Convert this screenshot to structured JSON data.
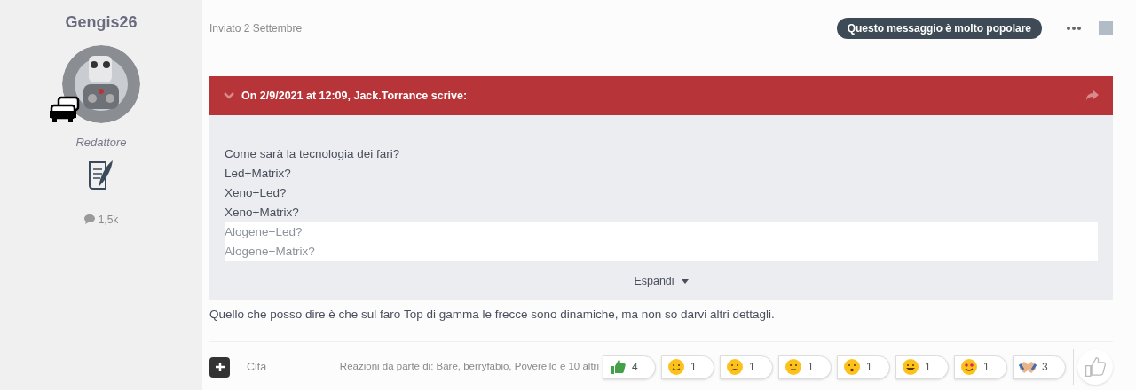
{
  "author": {
    "name": "Gengis26",
    "role": "Redattore",
    "posts": "1,5k"
  },
  "post": {
    "date": "Inviato 2 Settembre",
    "badge": "Questo messaggio è molto popolare",
    "select_checked": false,
    "quote": {
      "header": "On 2/9/2021 at 12:09, Jack.Torrance scrive:",
      "expanded": false,
      "lines": [
        {
          "text": "Come sarà la tecnologia dei fari?",
          "faded": false
        },
        {
          "text": "Led+Matrix?",
          "faded": false
        },
        {
          "text": "Xeno+Led?",
          "faded": false
        },
        {
          "text": "Xeno+Matrix?",
          "faded": false
        },
        {
          "text": "Alogene+Led?",
          "faded": true
        },
        {
          "text": "Alogene+Matrix?",
          "faded": true
        }
      ],
      "expand_label": "Espandi"
    },
    "body": "Quello che posso dire è che sul faro Top di gamma le frecce sono dinamiche, ma non so darvi altri dettagli."
  },
  "footer": {
    "quote_label": "Cita",
    "reactions_by": "Reazioni da parte di: Bare, berryfabio, Poverello e 10 altri",
    "reactions": [
      {
        "kind": "like",
        "count": "4"
      },
      {
        "kind": "crazy",
        "count": "1"
      },
      {
        "kind": "sad",
        "count": "1"
      },
      {
        "kind": "thinking",
        "count": "1"
      },
      {
        "kind": "surprised",
        "count": "1"
      },
      {
        "kind": "laugh",
        "count": "1"
      },
      {
        "kind": "love",
        "count": "1"
      },
      {
        "kind": "handshake",
        "count": "3"
      }
    ]
  }
}
